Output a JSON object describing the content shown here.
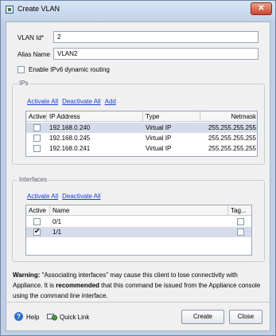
{
  "window": {
    "title": "Create VLAN",
    "close": "✕"
  },
  "form": {
    "vlan_id_label": "VLAN Id*",
    "vlan_id_value": "2",
    "alias_label": "Alias Name",
    "alias_value": "VLAN2",
    "ipv6_label": "Enable IPv6 dynamic routing"
  },
  "ips": {
    "group_title": "IPs",
    "links": [
      "Activate All",
      "Deactivate All",
      "Add"
    ],
    "columns": [
      "Active",
      "IP Address",
      "Type",
      "Netmask"
    ],
    "rows": [
      {
        "active": false,
        "ip": "192.168.0.240",
        "type": "Virtual IP",
        "netmask": "255.255.255.255",
        "selected": true
      },
      {
        "active": false,
        "ip": "192.168.0.245",
        "type": "Virtual IP",
        "netmask": "255.255.255.255",
        "selected": false
      },
      {
        "active": false,
        "ip": "192.168.0.241",
        "type": "Virtual IP",
        "netmask": "255.255.255.255",
        "selected": false
      }
    ]
  },
  "interfaces": {
    "group_title": "Interfaces",
    "links": [
      "Activate All",
      "Deactivate All"
    ],
    "columns": [
      "Active",
      "Name",
      "Tag..."
    ],
    "rows": [
      {
        "active": false,
        "name": "0/1",
        "tagged": false,
        "selected": false
      },
      {
        "active": true,
        "name": "1/1",
        "tagged": false,
        "selected": true
      }
    ]
  },
  "warning": {
    "label": "Warning:",
    "text_a": " \"Associating interfaces\" may cause this client to lose connectivity with Appliance. It is ",
    "emphasis": "recommended",
    "text_b": " that this command be issued from the Appliance console using the command line interface."
  },
  "footer": {
    "help": "Help",
    "quick_link": "Quick Link",
    "create": "Create",
    "close": "Close"
  }
}
